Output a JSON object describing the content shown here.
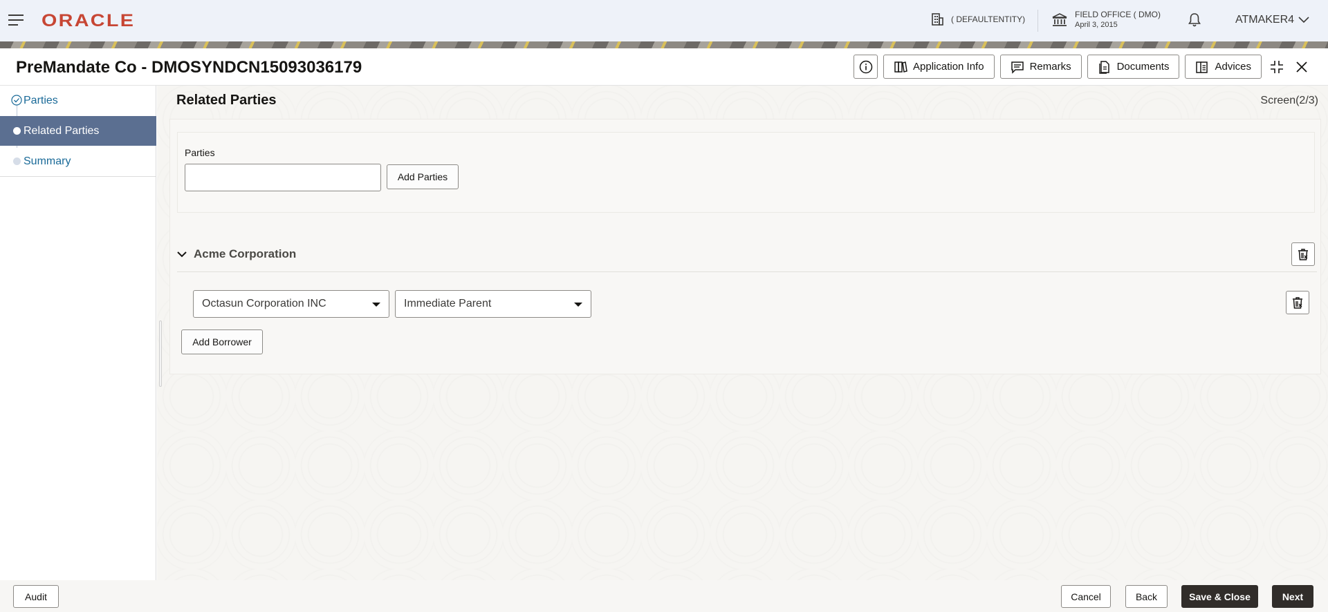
{
  "header": {
    "logo": "ORACLE",
    "entity": "( DEFAULTENTITY)",
    "office_name": "FIELD OFFICE ( DMO)",
    "office_date": "April 3, 2015",
    "user": "ATMAKER4"
  },
  "titlebar": {
    "title": "PreMandate Co - DMOSYNDCN15093036179",
    "actions": {
      "application_info": "Application Info",
      "remarks": "Remarks",
      "documents": "Documents",
      "advices": "Advices"
    }
  },
  "nav": {
    "items": [
      {
        "label": "Parties",
        "state": "completed"
      },
      {
        "label": "Related Parties",
        "state": "active"
      },
      {
        "label": "Summary",
        "state": "pending"
      }
    ]
  },
  "main": {
    "section_title": "Related Parties",
    "screen_count": "Screen(2/3)",
    "parties_label": "Parties",
    "parties_value": "",
    "add_parties_label": "Add Parties",
    "group_title": "Acme Corporation",
    "related_party": "Octasun Corporation INC",
    "relationship": "Immediate Parent",
    "add_borrower_label": "Add Borrower"
  },
  "footer": {
    "audit": "Audit",
    "cancel": "Cancel",
    "back": "Back",
    "save_close": "Save & Close",
    "next": "Next"
  },
  "colors": {
    "brand": "#c74634",
    "nav_active": "#5b6f91",
    "link": "#1a6a98",
    "primary_button": "#312d2a"
  }
}
